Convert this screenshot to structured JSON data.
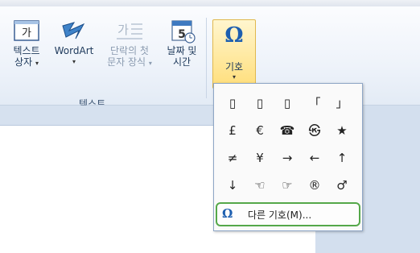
{
  "ribbon": {
    "text_box": {
      "line1": "텍스트",
      "line2": "상자",
      "arrow": "▾",
      "icon_text": "가"
    },
    "wordart": {
      "line1": "WordArt",
      "arrow": "▾"
    },
    "drop_cap": {
      "line1": "단락의 첫",
      "line2": "문자 장식",
      "arrow": "▾",
      "icon_text": "가"
    },
    "date_time": {
      "line1": "날짜 및",
      "line2": "시간",
      "icon_text": "5"
    },
    "group_label": "텍스트",
    "symbol": {
      "label": "기호",
      "arrow": "▾",
      "glyph": "Ω"
    }
  },
  "symbols": [
    "▯",
    "▯",
    "▯",
    "「",
    "」",
    "£",
    "€",
    "☎",
    "㉿",
    "★",
    "≠",
    "¥",
    "→",
    "←",
    "↑",
    "↓",
    "☜",
    "☞",
    "®",
    "♂"
  ],
  "more_symbols": {
    "glyph": "Ω",
    "label": "다른 기호(M)..."
  }
}
